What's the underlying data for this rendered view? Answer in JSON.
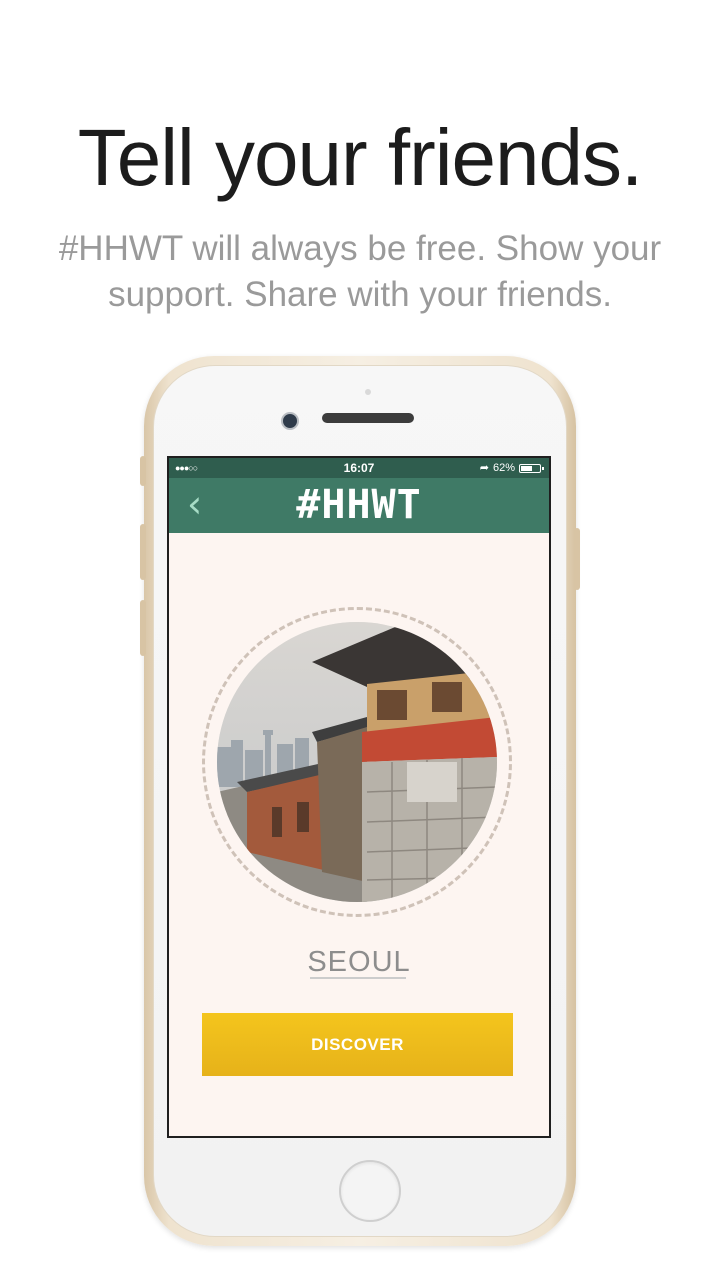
{
  "promo": {
    "headline": "Tell your friends.",
    "subline": "#HHWT will always be free. Show your support. Share with your friends."
  },
  "status_bar": {
    "signal": "●●●○○",
    "time": "16:07",
    "location_icon": "location-arrow-icon",
    "battery": "62%",
    "battery_level": 0.62
  },
  "nav": {
    "back_icon": "chevron-left-icon",
    "logo": "#HHWT"
  },
  "content": {
    "city_name": "SEOUL",
    "discover_label": "DISCOVER"
  },
  "colors": {
    "nav_green": "#3f7a66",
    "button_yellow": "#f4c51d",
    "screen_background": "#fdf5f1"
  }
}
